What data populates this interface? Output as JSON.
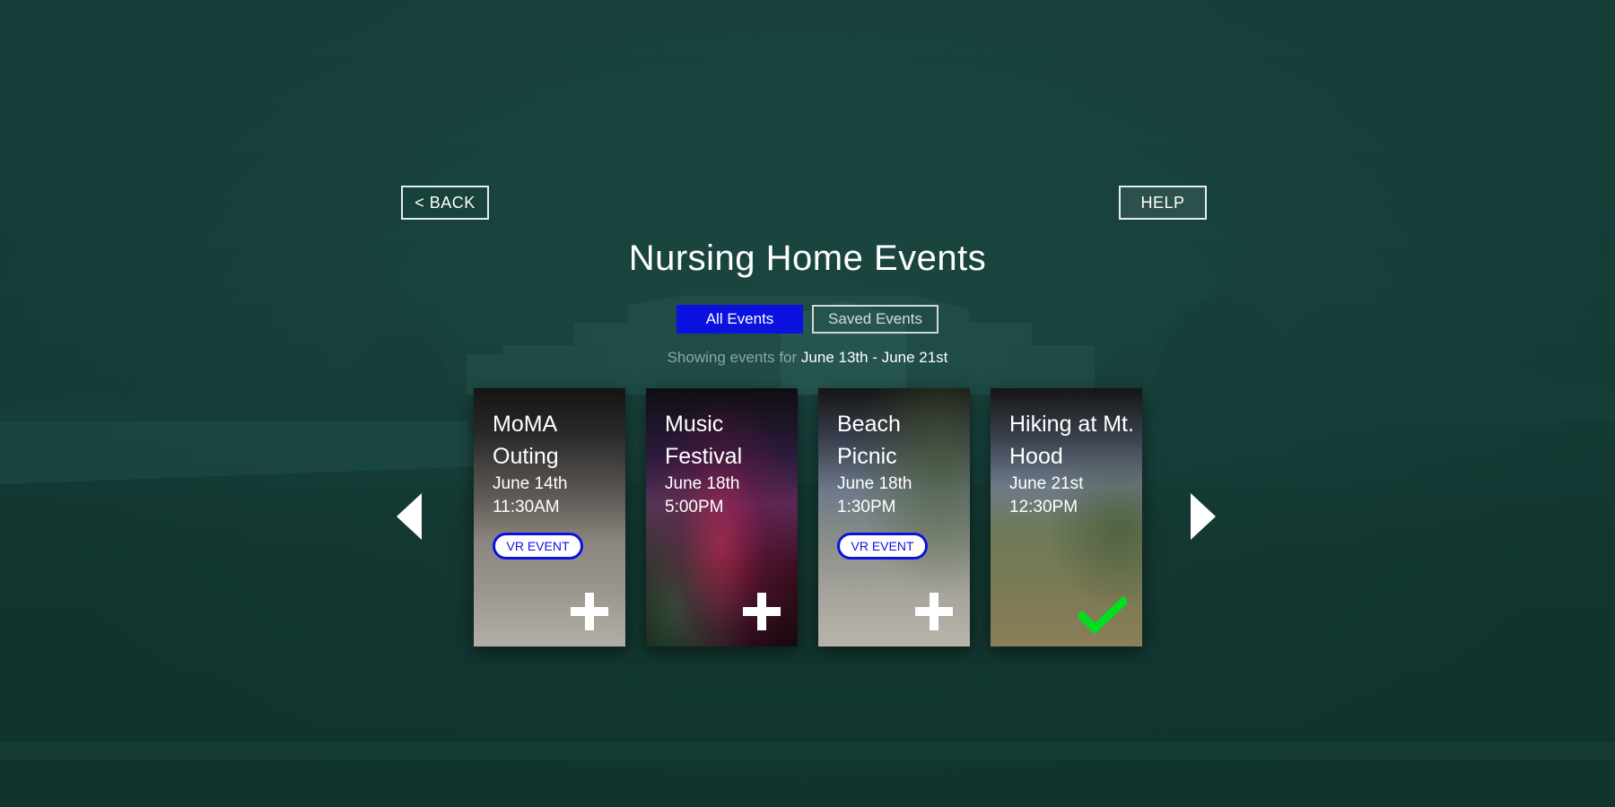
{
  "nav": {
    "back_label": "< BACK",
    "help_label": "HELP"
  },
  "page": {
    "title": "Nursing Home Events"
  },
  "tabs": [
    {
      "label": "All Events",
      "active": true
    },
    {
      "label": "Saved Events",
      "active": false
    }
  ],
  "date_range": {
    "prefix": "Showing events for",
    "range": "June 13th - June 21st"
  },
  "events": [
    {
      "title": "MoMA Outing",
      "date": "June 14th",
      "time": "11:30AM",
      "badge": "VR EVENT",
      "status": "add",
      "status_icon": "plus-icon"
    },
    {
      "title": "Music Festival",
      "date": "June 18th",
      "time": "5:00PM",
      "badge": "",
      "status": "add",
      "status_icon": "plus-icon"
    },
    {
      "title": "Beach Picnic",
      "date": "June 18th",
      "time": "1:30PM",
      "badge": "VR EVENT",
      "status": "add",
      "status_icon": "plus-icon"
    },
    {
      "title": "Hiking at Mt. Hood",
      "date": "June 21st",
      "time": "12:30PM",
      "badge": "",
      "status": "saved",
      "status_icon": "check-icon"
    }
  ],
  "icons": {
    "prev": "chevron-left-icon",
    "next": "chevron-right-icon"
  },
  "colors": {
    "accent_blue": "#0b12e0",
    "saved_green": "#00e020",
    "background": "#1b4741"
  }
}
